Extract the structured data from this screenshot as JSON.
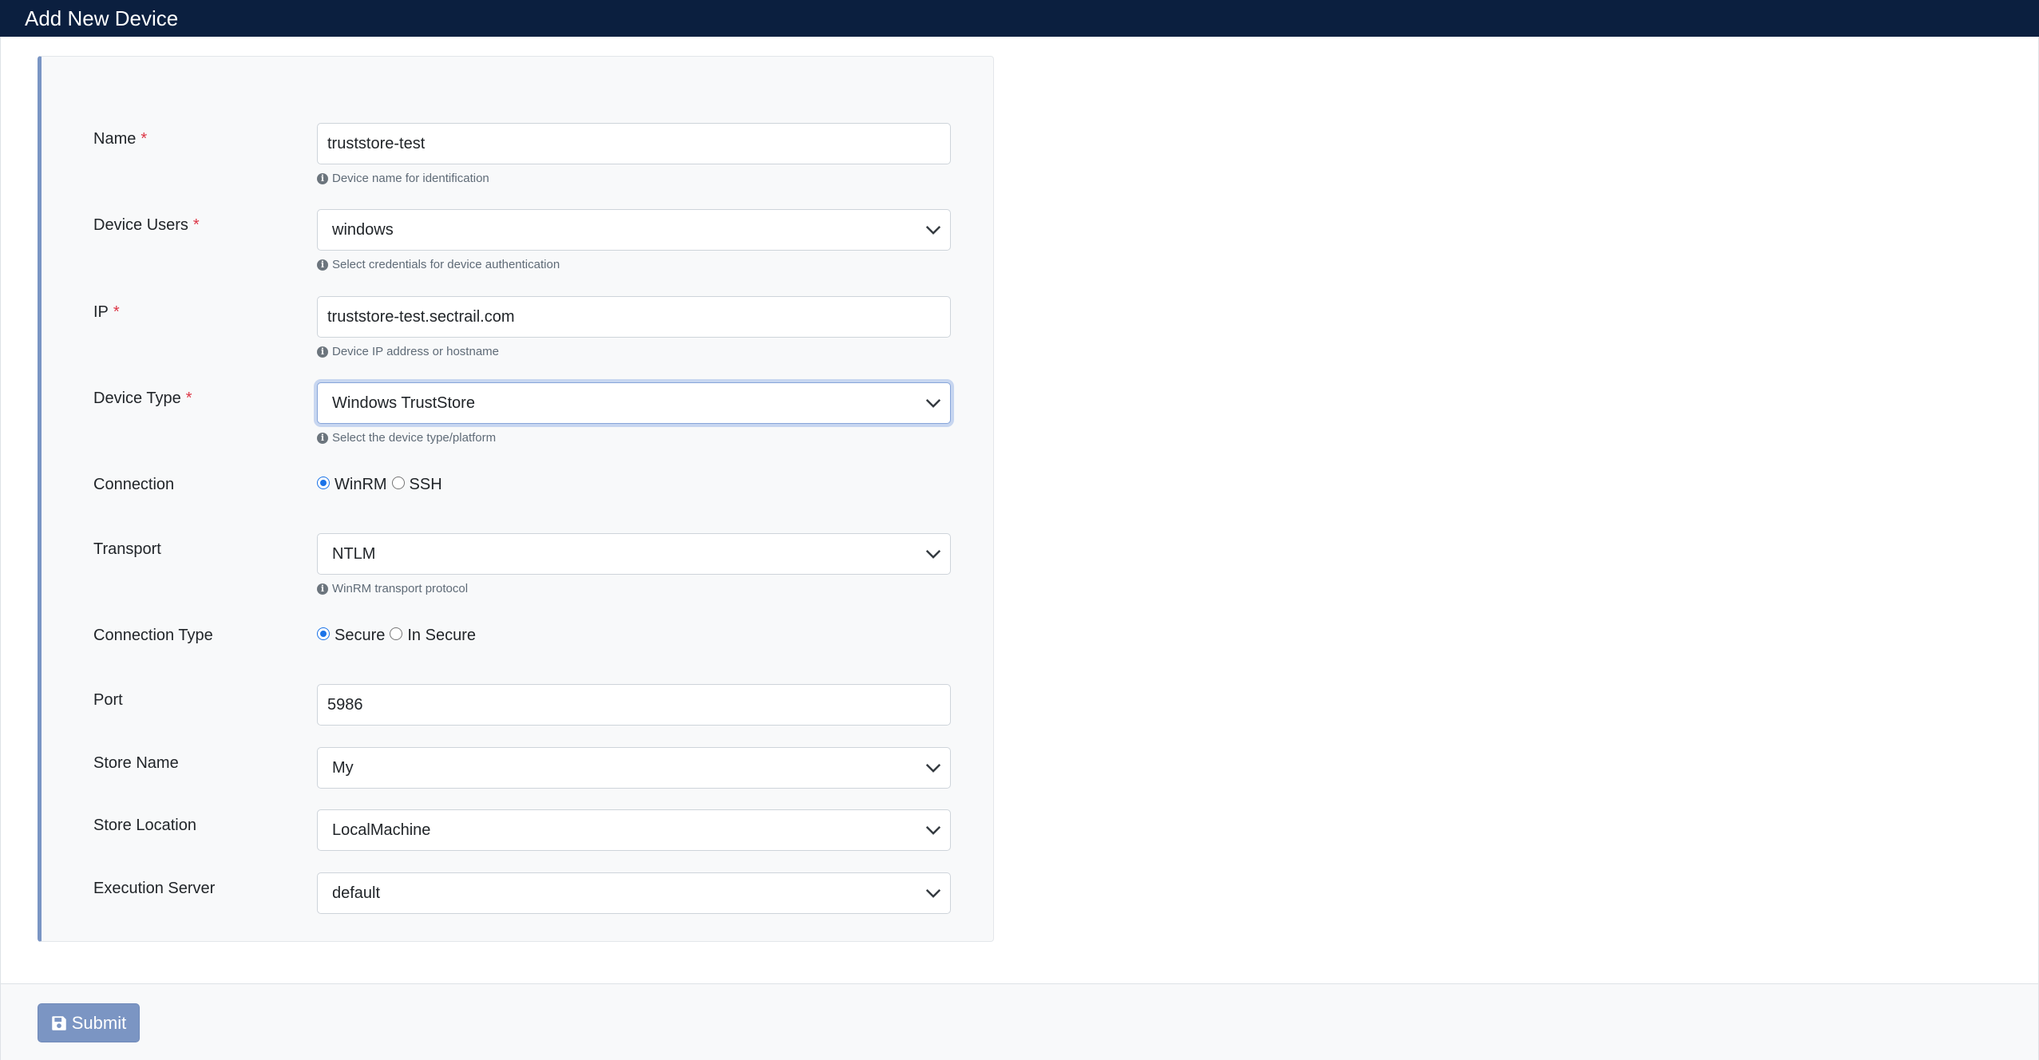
{
  "header": {
    "title": "Add New Device"
  },
  "form": {
    "name": {
      "label": "Name",
      "required": "*",
      "value": "truststore-test",
      "help": "Device name for identification"
    },
    "device_users": {
      "label": "Device Users",
      "required": "*",
      "value": "windows",
      "help": "Select credentials for device authentication"
    },
    "ip": {
      "label": "IP",
      "required": "*",
      "value": "truststore-test.sectrail.com",
      "help": "Device IP address or hostname"
    },
    "device_type": {
      "label": "Device Type",
      "required": "*",
      "value": "Windows TrustStore",
      "help": "Select the device type/platform"
    },
    "connection": {
      "label": "Connection",
      "options": [
        "WinRM",
        "SSH"
      ],
      "selected": "WinRM"
    },
    "transport": {
      "label": "Transport",
      "value": "NTLM",
      "help": "WinRM transport protocol"
    },
    "connection_type": {
      "label": "Connection Type",
      "options": [
        "Secure",
        "In Secure"
      ],
      "selected": "Secure"
    },
    "port": {
      "label": "Port",
      "value": "5986"
    },
    "store_name": {
      "label": "Store Name",
      "value": "My"
    },
    "store_location": {
      "label": "Store Location",
      "value": "LocalMachine"
    },
    "execution_server": {
      "label": "Execution Server",
      "value": "default"
    }
  },
  "footer": {
    "submit_label": "Submit"
  },
  "icons": {
    "info": "info-icon",
    "chevron": "chevron-down-icon",
    "save": "floppy-disk-icon"
  },
  "colors": {
    "header_bg": "#0b1f3f",
    "accent": "#7a95c4",
    "required": "#dc3545",
    "radio": "#1a73e8"
  }
}
